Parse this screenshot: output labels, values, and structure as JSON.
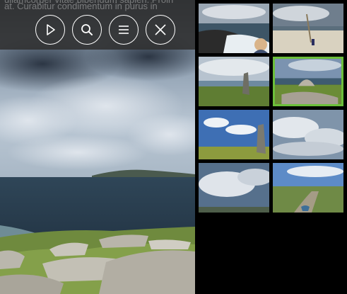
{
  "caption": {
    "line1": "ullamcorper vitae bibendum sapien. Proin",
    "line2": "at. Curabitur condimentum in purus in"
  },
  "controls": [
    {
      "name": "play-button",
      "icon": "play-icon"
    },
    {
      "name": "search-button",
      "icon": "search-icon"
    },
    {
      "name": "menu-button",
      "icon": "menu-icon"
    },
    {
      "name": "close-button",
      "icon": "close-icon"
    }
  ],
  "thumbnails": {
    "count": 8,
    "active_index": 3,
    "active_color": "#6cbf3a"
  }
}
